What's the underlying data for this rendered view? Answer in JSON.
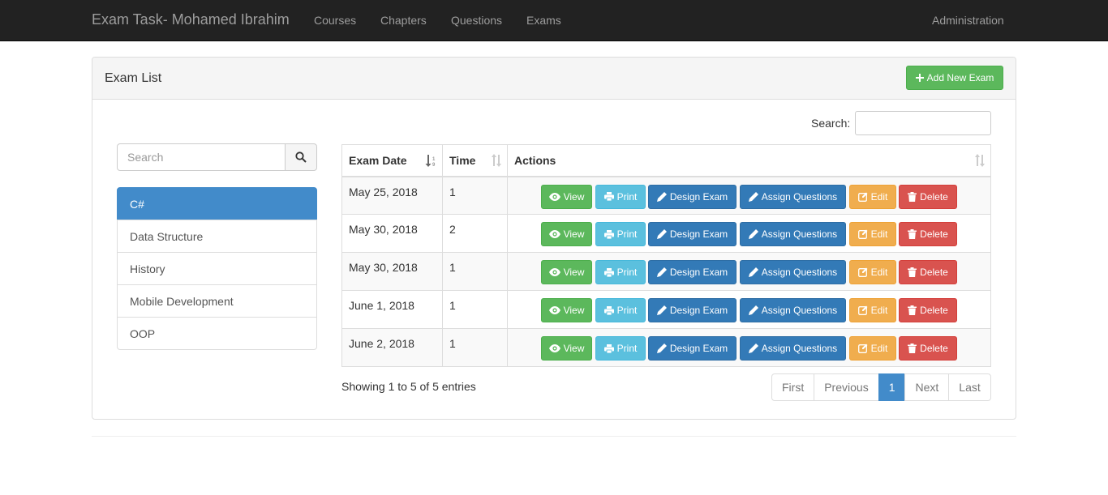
{
  "navbar": {
    "brand": "Exam Task- Mohamed Ibrahim",
    "links": [
      "Courses",
      "Chapters",
      "Questions",
      "Exams"
    ],
    "right_link": "Administration"
  },
  "panel": {
    "title": "Exam List",
    "add_button": "Add New Exam"
  },
  "sidebar": {
    "search_placeholder": "Search",
    "items": [
      "C#",
      "Data Structure",
      "History",
      "Mobile Development",
      "OOP"
    ],
    "active_index": 0
  },
  "table": {
    "search_label": "Search:",
    "headers": [
      "Exam Date",
      "Time",
      "Actions"
    ],
    "rows": [
      {
        "date": "May 25, 2018",
        "time": "1"
      },
      {
        "date": "May 30, 2018",
        "time": "2"
      },
      {
        "date": "May 30, 2018",
        "time": "1"
      },
      {
        "date": "June 1, 2018",
        "time": "1"
      },
      {
        "date": "June 2, 2018",
        "time": "1"
      }
    ],
    "action_labels": {
      "view": "View",
      "print": "Print",
      "design": "Design Exam",
      "assign": "Assign Questions",
      "edit": "Edit",
      "delete": "Delete"
    },
    "info": "Showing 1 to 5 of 5 entries"
  },
  "pagination": {
    "first": "First",
    "previous": "Previous",
    "current": "1",
    "next": "Next",
    "last": "Last"
  },
  "colors": {
    "navbar": "#222222",
    "success": "#5cb85c",
    "info": "#5bc0de",
    "primary": "#337ab7",
    "warning": "#f0ad4e",
    "danger": "#d9534f",
    "active": "#428bca"
  },
  "icons": {
    "add": "plus-icon",
    "search": "search-icon",
    "view": "eye-icon",
    "print": "print-icon",
    "design": "pencil-icon",
    "assign": "pencil-icon",
    "edit": "edit-icon",
    "delete": "trash-icon",
    "sort_date": "sort-desc-icon",
    "sort": "sort-icon"
  }
}
